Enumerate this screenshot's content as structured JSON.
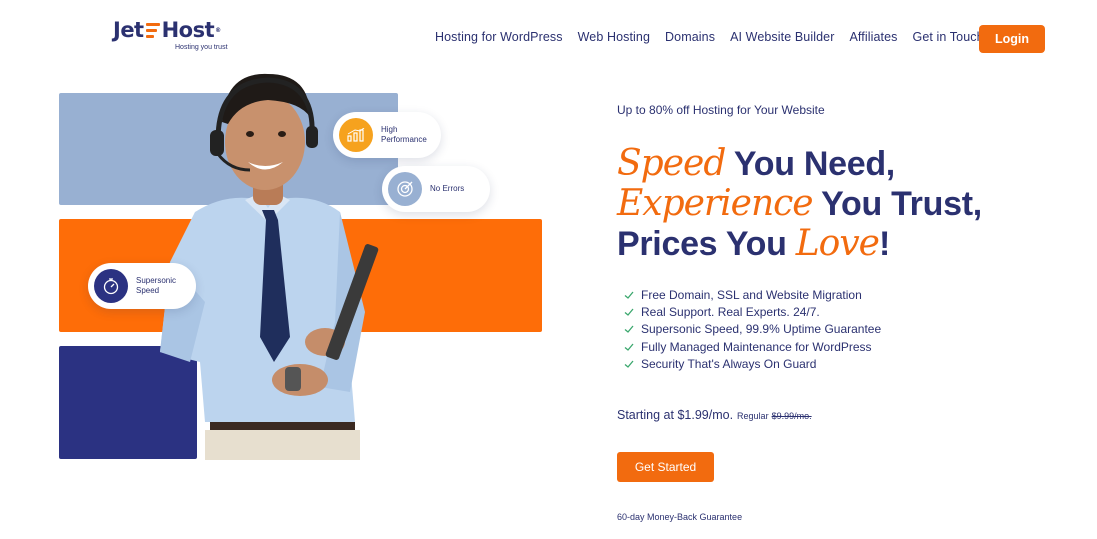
{
  "brand": {
    "name_part1": "Jet",
    "name_part2": "Host",
    "registered": "®",
    "tagline": "Hosting you trust"
  },
  "nav": {
    "items": [
      "Hosting for WordPress",
      "Web Hosting",
      "Domains",
      "AI Website Builder",
      "Affiliates",
      "Get in Touch"
    ],
    "login_label": "Login"
  },
  "badges": {
    "performance": "High Performance",
    "errors": "No Errors",
    "speed": "Supersonic Speed"
  },
  "hero": {
    "promo": "Up to 80% off Hosting for Your Website",
    "line1_script": "Speed",
    "line1_rest": " You Need,",
    "line2_script": "Experience",
    "line2_rest": " You Trust,",
    "line3_start": "Prices You ",
    "line3_script": "Love",
    "line3_end": "!"
  },
  "features": [
    "Free Domain, SSL and Website Migration",
    "Real Support. Real Experts. 24/7.",
    "Supersonic Speed, 99.9% Uptime Guarantee",
    "Fully Managed Maintenance for WordPress",
    "Security That's Always On Guard"
  ],
  "pricing": {
    "starting": "Starting at $1.99/mo.",
    "regular_label": "Regular",
    "regular_price": "$9.99/mo."
  },
  "cta": {
    "label": "Get Started",
    "guarantee": "60-day Money-Back Guarantee"
  },
  "colors": {
    "brand_navy": "#2b3170",
    "brand_orange": "#f26b0f",
    "block_blue": "#98b0d2",
    "block_orange": "#fe6d08",
    "block_navy": "#2b3282",
    "check_green": "#3aa76d"
  },
  "icons": {
    "performance": "bar-chart-icon",
    "errors": "target-icon",
    "speed": "stopwatch-icon",
    "feature": "check-icon"
  }
}
